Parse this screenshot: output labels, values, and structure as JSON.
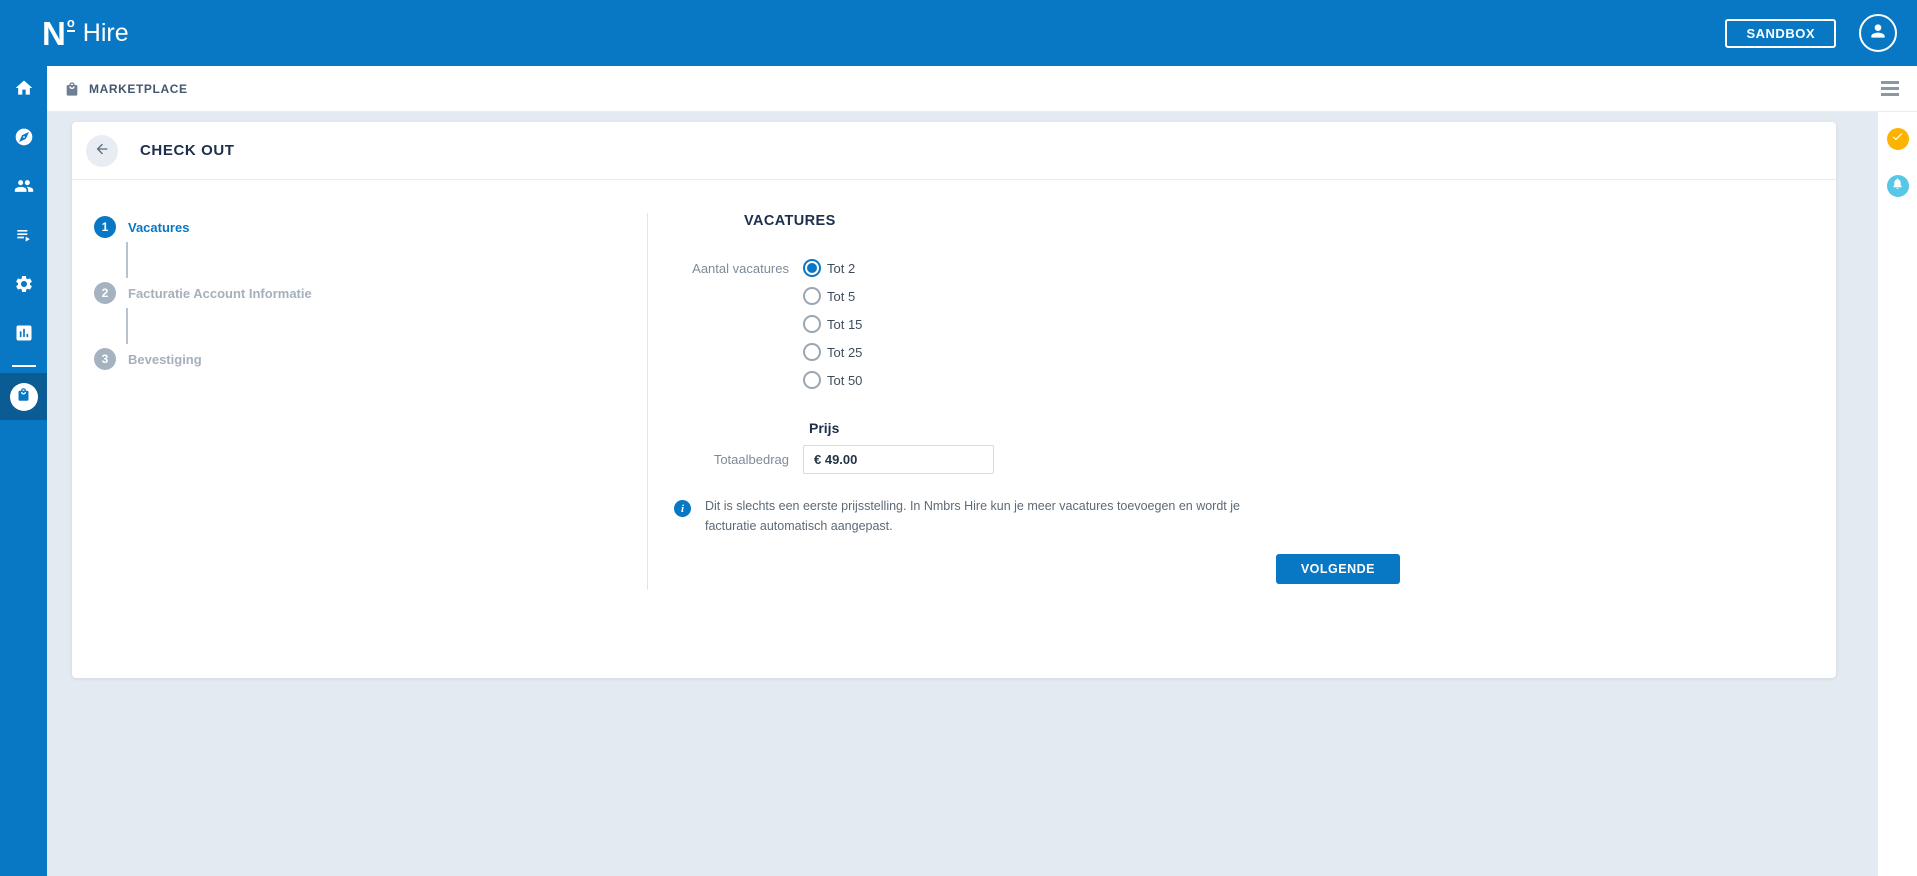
{
  "header": {
    "logo": {
      "n": "N",
      "o": "o",
      "product": "Hire"
    },
    "sandbox_label": "SANDBOX"
  },
  "breadcrumb": {
    "label": "MARKETPLACE"
  },
  "sidebar": {
    "icons": [
      "home",
      "explore",
      "users",
      "playlist",
      "settings",
      "reports"
    ],
    "active_icon": "marketplace"
  },
  "right_rail": {
    "icons": [
      "check",
      "notifications"
    ]
  },
  "checkout": {
    "title": "CHECK OUT",
    "steps": [
      {
        "number": "1",
        "label": "Vacatures",
        "active": true
      },
      {
        "number": "2",
        "label": "Facturatie Account Informatie",
        "active": false
      },
      {
        "number": "3",
        "label": "Bevestiging",
        "active": false
      }
    ],
    "form": {
      "section_title": "VACATURES",
      "aantal_label": "Aantal vacatures",
      "options": [
        {
          "label": "Tot 2",
          "selected": true
        },
        {
          "label": "Tot 5",
          "selected": false
        },
        {
          "label": "Tot 15",
          "selected": false
        },
        {
          "label": "Tot 25",
          "selected": false
        },
        {
          "label": "Tot 50",
          "selected": false
        }
      ],
      "price_title": "Prijs",
      "total_label": "Totaalbedrag",
      "total_value": "€ 49.00",
      "info_icon_glyph": "i",
      "info_text": "Dit is slechts een eerste prijsstelling. In Nmbrs Hire kun je meer vacatures toevoegen en wordt je facturatie automatisch aangepast.",
      "next_label": "VOLGENDE"
    }
  },
  "colors": {
    "primary_blue": "#0878c4",
    "active_sidebar": "#0b5c95",
    "navy_text": "#1c2f4d",
    "background": "#e4eaf1",
    "warning_orange": "#fcb400",
    "info_cyan": "#58c6e6"
  }
}
